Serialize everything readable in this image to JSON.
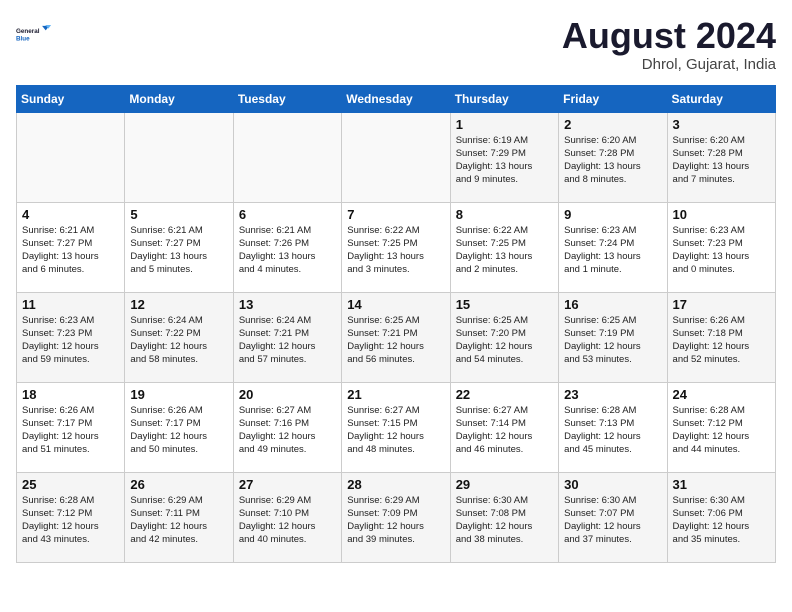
{
  "header": {
    "logo_general": "General",
    "logo_blue": "Blue",
    "month_year": "August 2024",
    "location": "Dhrol, Gujarat, India"
  },
  "days_of_week": [
    "Sunday",
    "Monday",
    "Tuesday",
    "Wednesday",
    "Thursday",
    "Friday",
    "Saturday"
  ],
  "weeks": [
    [
      {
        "day": "",
        "info": ""
      },
      {
        "day": "",
        "info": ""
      },
      {
        "day": "",
        "info": ""
      },
      {
        "day": "",
        "info": ""
      },
      {
        "day": "1",
        "info": "Sunrise: 6:19 AM\nSunset: 7:29 PM\nDaylight: 13 hours\nand 9 minutes."
      },
      {
        "day": "2",
        "info": "Sunrise: 6:20 AM\nSunset: 7:28 PM\nDaylight: 13 hours\nand 8 minutes."
      },
      {
        "day": "3",
        "info": "Sunrise: 6:20 AM\nSunset: 7:28 PM\nDaylight: 13 hours\nand 7 minutes."
      }
    ],
    [
      {
        "day": "4",
        "info": "Sunrise: 6:21 AM\nSunset: 7:27 PM\nDaylight: 13 hours\nand 6 minutes."
      },
      {
        "day": "5",
        "info": "Sunrise: 6:21 AM\nSunset: 7:27 PM\nDaylight: 13 hours\nand 5 minutes."
      },
      {
        "day": "6",
        "info": "Sunrise: 6:21 AM\nSunset: 7:26 PM\nDaylight: 13 hours\nand 4 minutes."
      },
      {
        "day": "7",
        "info": "Sunrise: 6:22 AM\nSunset: 7:25 PM\nDaylight: 13 hours\nand 3 minutes."
      },
      {
        "day": "8",
        "info": "Sunrise: 6:22 AM\nSunset: 7:25 PM\nDaylight: 13 hours\nand 2 minutes."
      },
      {
        "day": "9",
        "info": "Sunrise: 6:23 AM\nSunset: 7:24 PM\nDaylight: 13 hours\nand 1 minute."
      },
      {
        "day": "10",
        "info": "Sunrise: 6:23 AM\nSunset: 7:23 PM\nDaylight: 13 hours\nand 0 minutes."
      }
    ],
    [
      {
        "day": "11",
        "info": "Sunrise: 6:23 AM\nSunset: 7:23 PM\nDaylight: 12 hours\nand 59 minutes."
      },
      {
        "day": "12",
        "info": "Sunrise: 6:24 AM\nSunset: 7:22 PM\nDaylight: 12 hours\nand 58 minutes."
      },
      {
        "day": "13",
        "info": "Sunrise: 6:24 AM\nSunset: 7:21 PM\nDaylight: 12 hours\nand 57 minutes."
      },
      {
        "day": "14",
        "info": "Sunrise: 6:25 AM\nSunset: 7:21 PM\nDaylight: 12 hours\nand 56 minutes."
      },
      {
        "day": "15",
        "info": "Sunrise: 6:25 AM\nSunset: 7:20 PM\nDaylight: 12 hours\nand 54 minutes."
      },
      {
        "day": "16",
        "info": "Sunrise: 6:25 AM\nSunset: 7:19 PM\nDaylight: 12 hours\nand 53 minutes."
      },
      {
        "day": "17",
        "info": "Sunrise: 6:26 AM\nSunset: 7:18 PM\nDaylight: 12 hours\nand 52 minutes."
      }
    ],
    [
      {
        "day": "18",
        "info": "Sunrise: 6:26 AM\nSunset: 7:17 PM\nDaylight: 12 hours\nand 51 minutes."
      },
      {
        "day": "19",
        "info": "Sunrise: 6:26 AM\nSunset: 7:17 PM\nDaylight: 12 hours\nand 50 minutes."
      },
      {
        "day": "20",
        "info": "Sunrise: 6:27 AM\nSunset: 7:16 PM\nDaylight: 12 hours\nand 49 minutes."
      },
      {
        "day": "21",
        "info": "Sunrise: 6:27 AM\nSunset: 7:15 PM\nDaylight: 12 hours\nand 48 minutes."
      },
      {
        "day": "22",
        "info": "Sunrise: 6:27 AM\nSunset: 7:14 PM\nDaylight: 12 hours\nand 46 minutes."
      },
      {
        "day": "23",
        "info": "Sunrise: 6:28 AM\nSunset: 7:13 PM\nDaylight: 12 hours\nand 45 minutes."
      },
      {
        "day": "24",
        "info": "Sunrise: 6:28 AM\nSunset: 7:12 PM\nDaylight: 12 hours\nand 44 minutes."
      }
    ],
    [
      {
        "day": "25",
        "info": "Sunrise: 6:28 AM\nSunset: 7:12 PM\nDaylight: 12 hours\nand 43 minutes."
      },
      {
        "day": "26",
        "info": "Sunrise: 6:29 AM\nSunset: 7:11 PM\nDaylight: 12 hours\nand 42 minutes."
      },
      {
        "day": "27",
        "info": "Sunrise: 6:29 AM\nSunset: 7:10 PM\nDaylight: 12 hours\nand 40 minutes."
      },
      {
        "day": "28",
        "info": "Sunrise: 6:29 AM\nSunset: 7:09 PM\nDaylight: 12 hours\nand 39 minutes."
      },
      {
        "day": "29",
        "info": "Sunrise: 6:30 AM\nSunset: 7:08 PM\nDaylight: 12 hours\nand 38 minutes."
      },
      {
        "day": "30",
        "info": "Sunrise: 6:30 AM\nSunset: 7:07 PM\nDaylight: 12 hours\nand 37 minutes."
      },
      {
        "day": "31",
        "info": "Sunrise: 6:30 AM\nSunset: 7:06 PM\nDaylight: 12 hours\nand 35 minutes."
      }
    ]
  ]
}
